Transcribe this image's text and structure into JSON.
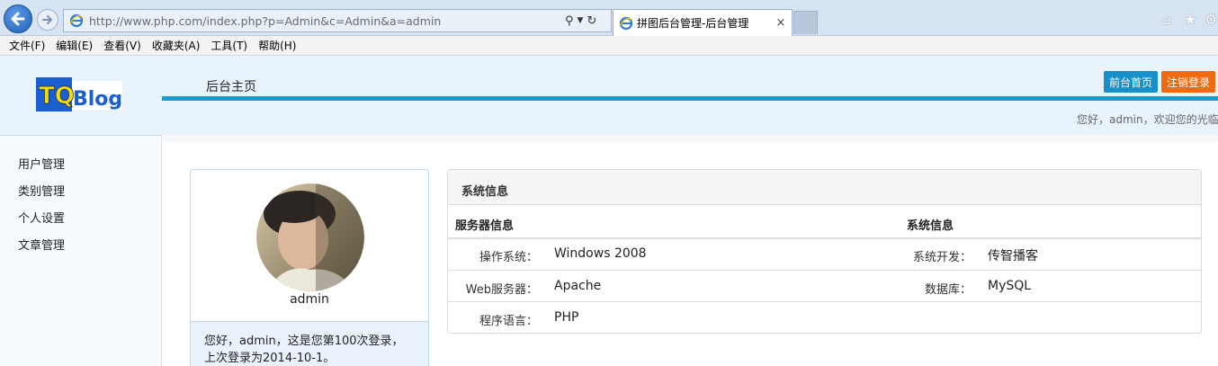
{
  "browser": {
    "address": "http://www.php.com/index.php?p=Admin&c=Admin&a=admin",
    "tab_title": "拼图后台管理-后台管理",
    "tab_close": "×",
    "menu": [
      "文件(F)",
      "编辑(E)",
      "查看(V)",
      "收藏夹(A)",
      "工具(T)",
      "帮助(H)"
    ]
  },
  "header": {
    "logo_text_left": "TQ",
    "logo_text_right": "Blog",
    "nav_tab": "后台主页",
    "btn_frontend": "前台首页",
    "btn_logout": "注销登录",
    "welcome": "您好，admin，欢迎您的光临"
  },
  "sidebar": {
    "items": [
      "用户管理",
      "类别管理",
      "个人设置",
      "文章管理"
    ]
  },
  "profile": {
    "name": "admin",
    "message": "您好，admin，这是您第100次登录，上次登录为2014-10-1。"
  },
  "system": {
    "title": "系统信息",
    "col_server": "服务器信息",
    "col_system": "系统信息",
    "rows": [
      {
        "label": "操作系统：",
        "value": "Windows 2008",
        "label2": "系统开发：",
        "value2": "传智播客"
      },
      {
        "label": "Web服务器：",
        "value": "Apache",
        "label2": "数据库：",
        "value2": "MySQL"
      },
      {
        "label": "程序语言：",
        "value": "PHP"
      }
    ]
  },
  "colors": {
    "accent": "#1a9bd0",
    "frontend_button": "#1790c9",
    "logout_button": "#f26a10",
    "header_bg": "#e8f3fc"
  }
}
